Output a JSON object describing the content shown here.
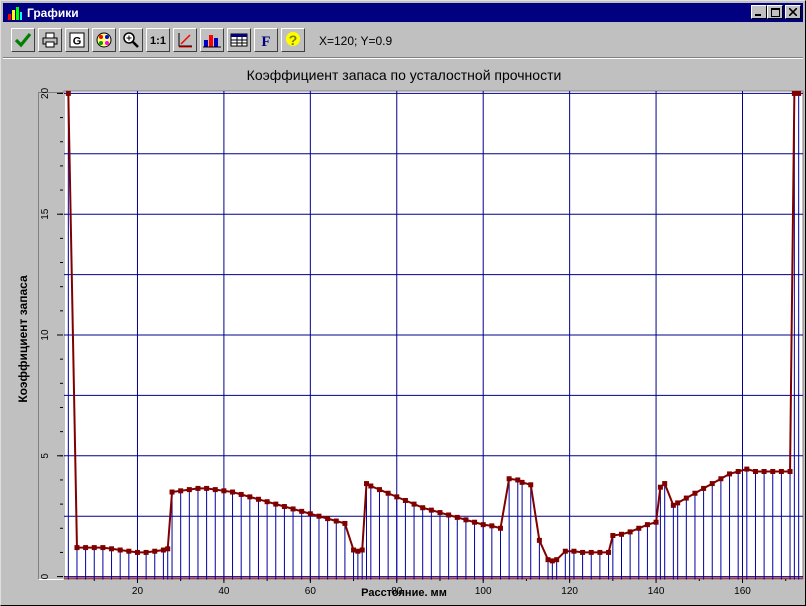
{
  "window": {
    "title": "Графики"
  },
  "toolbar": {
    "coord_readout": "X=120; Y=0.9",
    "buttons": [
      {
        "icon": "check-icon"
      },
      {
        "icon": "print-icon"
      },
      {
        "icon": "grid-icon"
      },
      {
        "icon": "palette-icon"
      },
      {
        "icon": "zoom-in-icon"
      },
      {
        "icon": "one-to-one-icon"
      },
      {
        "icon": "axis-scale-icon"
      },
      {
        "icon": "bar-chart-icon"
      },
      {
        "icon": "table-icon"
      },
      {
        "icon": "font-icon"
      },
      {
        "icon": "help-icon"
      }
    ],
    "one_to_one_label": "1:1",
    "font_label": "F"
  },
  "chart_data": {
    "type": "line",
    "title": "Коэффициент запаса по усталостной прочности",
    "xlabel": "Расстояние. мм",
    "ylabel": "Коэффициент запаса",
    "xlim": [
      3,
      174
    ],
    "ylim": [
      -0.1,
      20.1
    ],
    "xticks": [
      20,
      40,
      60,
      80,
      100,
      120,
      140,
      160
    ],
    "yticks": [
      0,
      5,
      10,
      15,
      20
    ],
    "grid": true,
    "colors": {
      "line": "#800000",
      "stem": "#0000a0",
      "grid": "#00008b",
      "zero": "#cc0000"
    },
    "series": [
      {
        "x": [
          4,
          6,
          8,
          10,
          12,
          14,
          16,
          18,
          20,
          22,
          24,
          26,
          27,
          28,
          30,
          32,
          34,
          36,
          38,
          40,
          42,
          44,
          46,
          48,
          50,
          52,
          54,
          56,
          58,
          60,
          62,
          64,
          66,
          68,
          70,
          71,
          72,
          73,
          74,
          76,
          78,
          80,
          82,
          84,
          86,
          88,
          90,
          92,
          94,
          96,
          98,
          100,
          102,
          104,
          106,
          108,
          109,
          111,
          113,
          115,
          116,
          117,
          119,
          121,
          123,
          125,
          127,
          129,
          130,
          132,
          134,
          136,
          138,
          140,
          141,
          142,
          144,
          145,
          147,
          149,
          151,
          153,
          155,
          157,
          159,
          161,
          163,
          165,
          167,
          169,
          171,
          172,
          173
        ],
        "y": [
          20,
          1.2,
          1.2,
          1.2,
          1.2,
          1.15,
          1.1,
          1.05,
          1.0,
          1.0,
          1.05,
          1.1,
          1.15,
          3.5,
          3.55,
          3.6,
          3.65,
          3.65,
          3.6,
          3.55,
          3.5,
          3.4,
          3.3,
          3.2,
          3.1,
          3.0,
          2.9,
          2.8,
          2.7,
          2.6,
          2.5,
          2.4,
          2.3,
          2.2,
          1.1,
          1.05,
          1.1,
          3.85,
          3.75,
          3.6,
          3.45,
          3.3,
          3.15,
          3.0,
          2.85,
          2.75,
          2.65,
          2.55,
          2.45,
          2.35,
          2.25,
          2.15,
          2.1,
          2.0,
          4.05,
          4.0,
          3.9,
          3.8,
          1.5,
          0.7,
          0.65,
          0.7,
          1.05,
          1.05,
          1.0,
          1.0,
          1.0,
          1.0,
          1.7,
          1.75,
          1.85,
          2.0,
          2.15,
          2.25,
          3.7,
          3.85,
          2.95,
          3.05,
          3.25,
          3.45,
          3.65,
          3.85,
          4.05,
          4.25,
          4.35,
          4.45,
          4.35,
          4.35,
          4.35,
          4.35,
          4.35,
          20,
          20
        ]
      }
    ]
  }
}
